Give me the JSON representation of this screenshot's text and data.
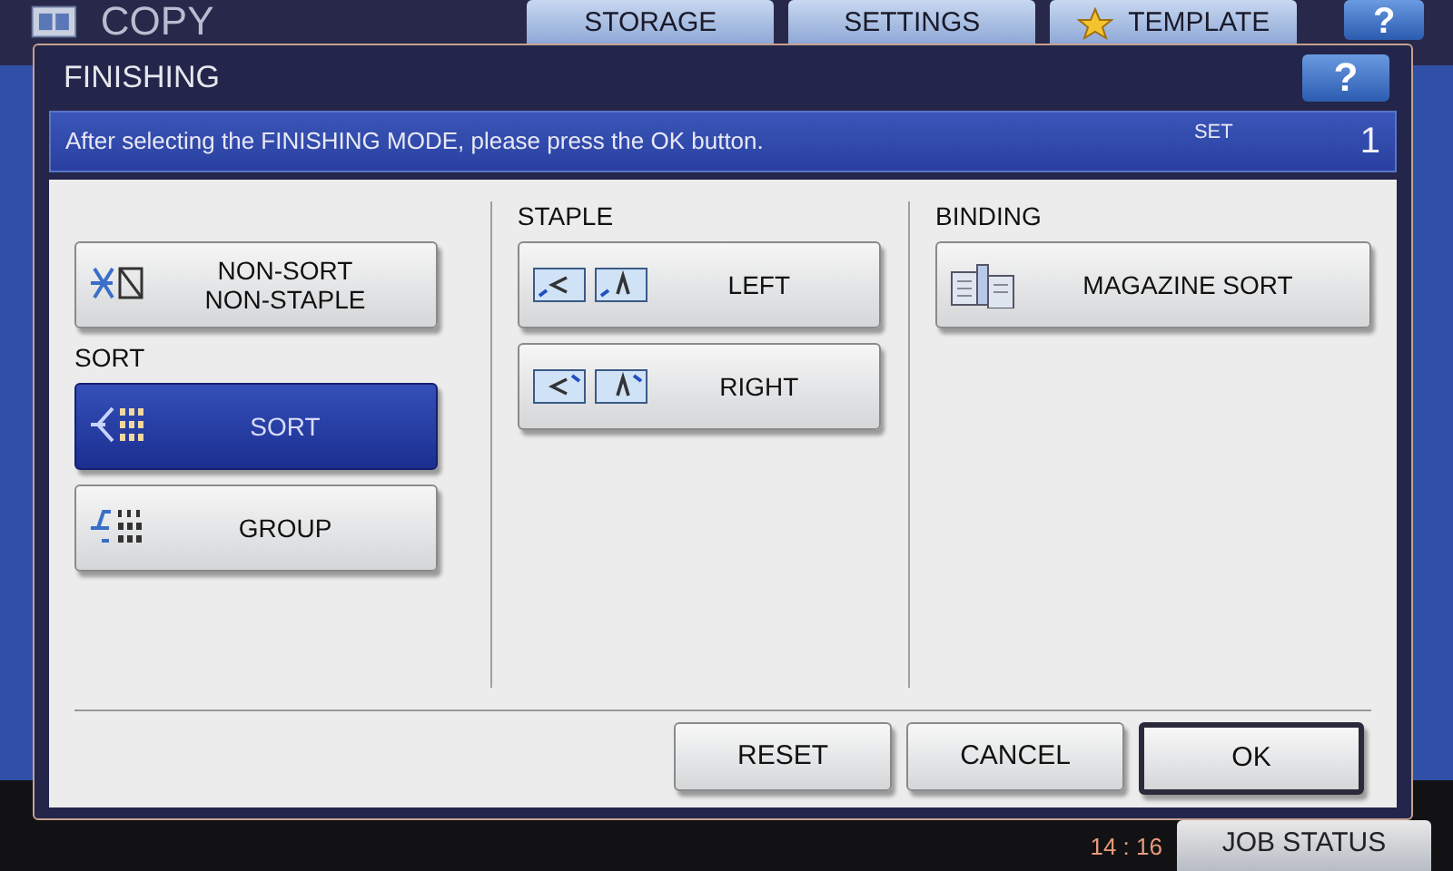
{
  "header": {
    "title": "COPY",
    "tabs": [
      {
        "label": "STORAGE"
      },
      {
        "label": "SETTINGS"
      },
      {
        "label": "TEMPLATE"
      }
    ],
    "help": "?"
  },
  "dialog": {
    "title": "FINISHING",
    "help": "?",
    "message": "After selecting the FINISHING MODE, please press the OK button.",
    "set_label": "SET",
    "set_count": "1",
    "columns": [
      {
        "items": [
          {
            "kind": "option",
            "label": "NON-SORT\nNON-STAPLE",
            "selected": false
          },
          {
            "kind": "heading",
            "label": "SORT"
          },
          {
            "kind": "option",
            "label": "SORT",
            "selected": true
          },
          {
            "kind": "option",
            "label": "GROUP",
            "selected": false
          }
        ]
      },
      {
        "items": [
          {
            "kind": "heading",
            "label": "STAPLE"
          },
          {
            "kind": "option",
            "label": "LEFT",
            "selected": false
          },
          {
            "kind": "option",
            "label": "RIGHT",
            "selected": false
          }
        ]
      },
      {
        "items": [
          {
            "kind": "heading",
            "label": "BINDING"
          },
          {
            "kind": "option",
            "label": "MAGAZINE SORT",
            "selected": false
          }
        ]
      }
    ],
    "buttons": [
      {
        "label": "RESET",
        "default": false
      },
      {
        "label": "CANCEL",
        "default": false
      },
      {
        "label": "OK",
        "default": true
      }
    ]
  },
  "status": {
    "time": "14 : 16",
    "job_status": "JOB STATUS"
  }
}
